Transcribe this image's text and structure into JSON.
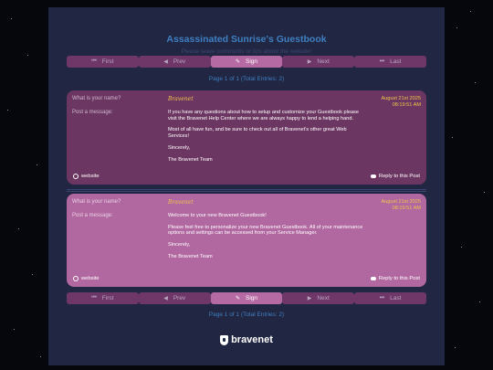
{
  "guestbook": {
    "title": "Assassinated Sunrise's Guestbook",
    "subtitle": "Please leave comments or tips about the website!"
  },
  "nav": {
    "first": "First",
    "prev": "Prev",
    "sign": "Sign",
    "next": "Next",
    "last": "Last"
  },
  "page_info": "Page 1 of 1 (Total Entries: 2)",
  "labels": {
    "name": "What is your name?",
    "message": "Post a message:",
    "website": "website",
    "reply": "Reply to this Post"
  },
  "entries": [
    {
      "author": "Bravenet",
      "date": "August 21st 2025",
      "time": "08:19:51 AM",
      "paragraphs": [
        "If you have any questions about how to setup and customize your Guestbook please visit the Bravenet Help Center where we are always happy to lend a helping hand.",
        "Most of all have fun, and be sure to check out all of Bravenet's other great Web Services!",
        "Sincerely,",
        "The Bravenet Team"
      ]
    },
    {
      "author": "Bravenet",
      "date": "August 21st 2025",
      "time": "08:19:51 AM",
      "paragraphs": [
        "Welcome to your new Bravenet Guestbook!",
        "Please feel free to personalize your new Bravenet Guestbook. All of your maintenance options and settings can be accessed from your Service Manager.",
        "Sincerely,",
        "The Bravenet Team"
      ]
    }
  ],
  "footer": {
    "brand": "bravenet"
  },
  "colors": {
    "background": "#05070c",
    "panel": "#212642",
    "title": "#3f7fc1",
    "button": "#6e3768",
    "button_active": "#b66aa3",
    "entry_dark": "#6c3662",
    "entry_light": "#b167a0",
    "author": "#f0c64a"
  }
}
